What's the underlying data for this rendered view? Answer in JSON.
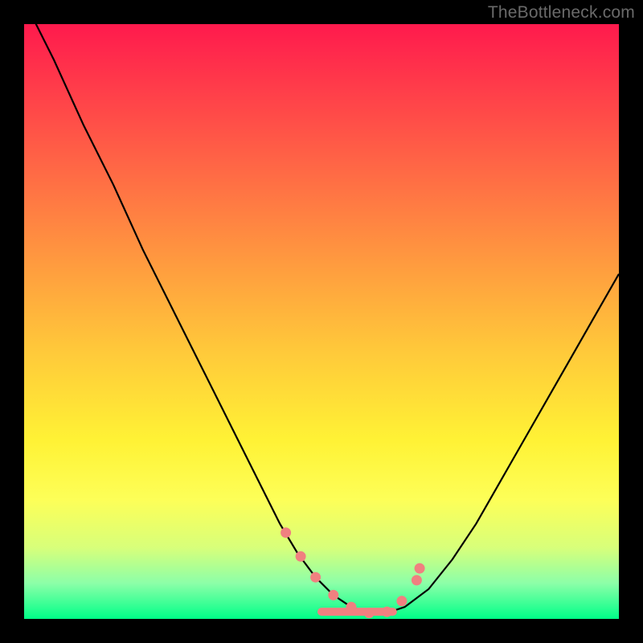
{
  "watermark": "TheBottleneck.com",
  "chart_data": {
    "type": "line",
    "title": "",
    "xlabel": "",
    "ylabel": "",
    "xlim": [
      0,
      100
    ],
    "ylim": [
      0,
      100
    ],
    "background_gradient": {
      "top": "#ff1a4d",
      "mid_upper": "#ff9a3f",
      "mid": "#fff235",
      "mid_lower": "#d8ff7a",
      "bottom": "#00ff88"
    },
    "series": [
      {
        "name": "bottleneck-curve",
        "x": [
          0,
          5,
          10,
          15,
          20,
          25,
          30,
          35,
          40,
          43,
          46,
          49,
          52,
          55,
          58,
          61,
          64,
          68,
          72,
          76,
          80,
          84,
          88,
          92,
          96,
          100
        ],
        "y": [
          104,
          94,
          83,
          73,
          62,
          52,
          42,
          32,
          22,
          16,
          11,
          7,
          4,
          2,
          1,
          1,
          2,
          5,
          10,
          16,
          23,
          30,
          37,
          44,
          51,
          58
        ]
      }
    ],
    "markers": {
      "name": "highlight-points",
      "color": "#f08080",
      "x": [
        44,
        46.5,
        49,
        52,
        55,
        58,
        61,
        63.5,
        66,
        66.5
      ],
      "y": [
        14.5,
        10.5,
        7,
        4,
        2,
        1,
        1.2,
        3,
        6.5,
        8.5
      ]
    },
    "flat_segment": {
      "x_start": 50,
      "x_end": 62,
      "y": 1.2
    }
  }
}
